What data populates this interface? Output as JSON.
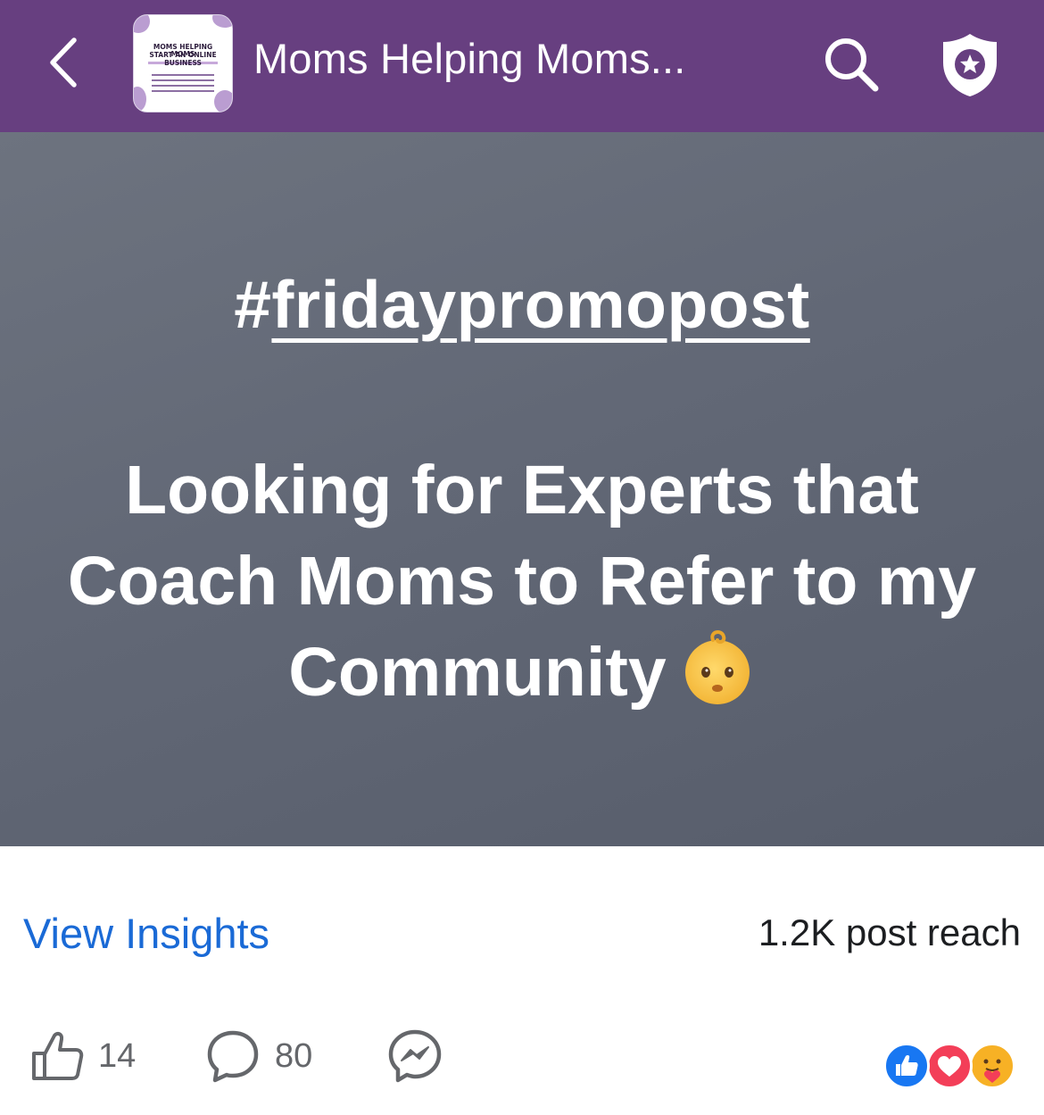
{
  "header": {
    "title": "Moms Helping Moms...",
    "thumbnail_text": {
      "line1": "MOMS HELPING MOMS",
      "line2": "START AN ONLINE",
      "line3": "BUSINESS"
    },
    "icons": [
      "back-chevron-icon",
      "search-icon",
      "shield-star-icon"
    ]
  },
  "post": {
    "hashtag_prefix": "#",
    "hashtag_text": "fridaypromopost",
    "body": "Looking for Experts that Coach Moms to Refer to my Community",
    "emoji": "baby-face-emoji"
  },
  "insights": {
    "link_label": "View Insights",
    "reach": "1.2K post reach"
  },
  "actions": {
    "likes": "14",
    "comments": "80"
  },
  "reactions": [
    "like",
    "love",
    "care"
  ],
  "colors": {
    "header_bg": "#673f80",
    "banner_bg": "#626876",
    "link": "#1a6ad6",
    "like_blue": "#1877f2",
    "love_red": "#f33e58",
    "care_yellow": "#f7b125"
  }
}
